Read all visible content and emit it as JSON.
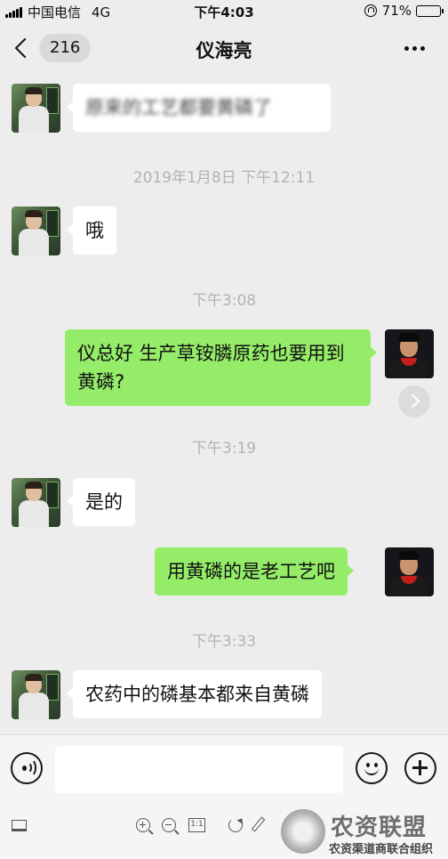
{
  "status_bar": {
    "carrier": "中国电信",
    "network": "4G",
    "time": "下午4:03",
    "battery": "71%",
    "battery_level": 0.71
  },
  "nav": {
    "unread_count": "216",
    "title": "仪海亮"
  },
  "messages": [
    {
      "side": "left",
      "text": "原来的工艺都要黄磷了",
      "blurred": true
    },
    {
      "type": "time",
      "text": "2019年1月8日 下午12:11"
    },
    {
      "side": "left",
      "text": "哦"
    },
    {
      "type": "time",
      "text": "下午3:08"
    },
    {
      "side": "right",
      "text": "仪总好 生产草铵膦原药也要用到黄磷?"
    },
    {
      "type": "time",
      "text": "下午3:19"
    },
    {
      "side": "left",
      "text": "是的"
    },
    {
      "side": "right",
      "text": "用黄磷的是老工艺吧"
    },
    {
      "type": "time",
      "text": "下午3:33"
    },
    {
      "side": "left",
      "text": "农药中的磷基本都来自黄磷"
    }
  ],
  "input": {
    "value": "",
    "placeholder": ""
  },
  "viewer_toolbar": {
    "actual_size_label": "1:1"
  },
  "watermark": {
    "title": "农资联盟",
    "subtitle": "农资渠道商联合组织"
  },
  "colors": {
    "background": "#ededed",
    "bubble_right": "#95ec69",
    "bubble_left": "#ffffff",
    "timestamp": "#b3b3b3"
  }
}
